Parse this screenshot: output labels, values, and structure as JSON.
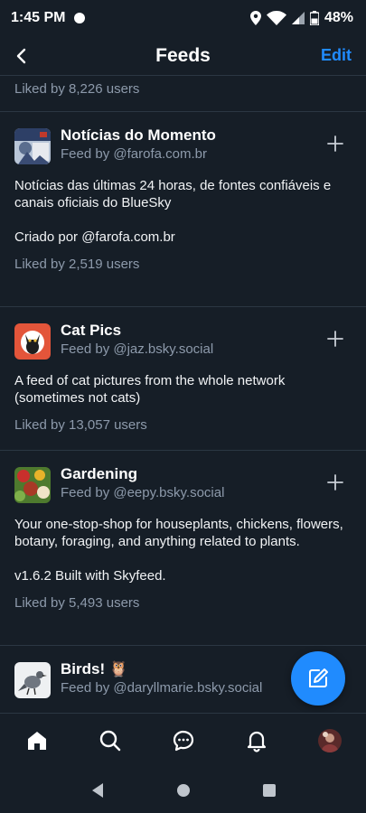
{
  "status": {
    "time": "1:45 PM",
    "battery": "48%"
  },
  "header": {
    "title": "Feeds",
    "edit_label": "Edit"
  },
  "top_liked": "Liked by 8,226 users",
  "feeds": [
    {
      "name": "Notícias do Momento",
      "by": "Feed by @farofa.com.br",
      "description": "Notícias das últimas 24 horas, de fontes confiáveis e canais oficiais do BlueSky\n\nCriado por @farofa.com.br",
      "liked": "Liked by 2,519 users"
    },
    {
      "name": "Cat Pics",
      "by": "Feed by @jaz.bsky.social",
      "description": "A feed of cat pictures from the whole network (sometimes not cats)",
      "liked": "Liked by 13,057 users"
    },
    {
      "name": "Gardening",
      "by": "Feed by @eepy.bsky.social",
      "description": "Your one-stop-shop for houseplants, chickens, flowers, botany, foraging, and anything related to plants.\n\nv1.6.2 Built with Skyfeed.",
      "liked": "Liked by 5,493 users"
    },
    {
      "name": "Birds! 🦉",
      "by": "Feed by @daryllmarie.bsky.social",
      "description": "",
      "liked": ""
    }
  ],
  "colors": {
    "accent": "#208bfe",
    "background": "#161e27",
    "muted": "#8d9aab",
    "divider": "#2b3743"
  }
}
